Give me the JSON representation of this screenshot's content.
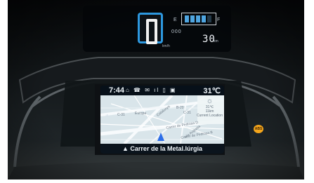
{
  "cluster": {
    "gear_display": "",
    "fuel_empty": "E",
    "fuel_full": "F",
    "fuel_level_percent": 75,
    "trip_label": "000",
    "distance_value": "30",
    "distance_unit": "km",
    "speed_unit": "km/h"
  },
  "screen": {
    "time": "7:44",
    "temperature": "31℃",
    "status_icons": "⌂ ☎ ✉ ıl ▯ ▣",
    "weather_temp": "31℃",
    "weather_extra": "11km",
    "weather_label": "Current Location",
    "zoom_plus": "+",
    "zoom_minus": "−",
    "map_labels": [
      "C-31",
      "Europa",
      "B-20",
      "C-31",
      "Carrer de Pedrosa D",
      "Carrer de Pedrosa B",
      "Catalunya",
      "Via Augusta"
    ],
    "street_name": "▲ Carrer de la Metal.lúrgia"
  },
  "indicator": {
    "warning_text": "ABS"
  },
  "colors": {
    "dashboard_dark": "#101315",
    "display_blue": "#2d98df",
    "map_bg": "#d9e5ea",
    "warning": "#f3a51c",
    "nav_blue": "#2d6ee8"
  }
}
